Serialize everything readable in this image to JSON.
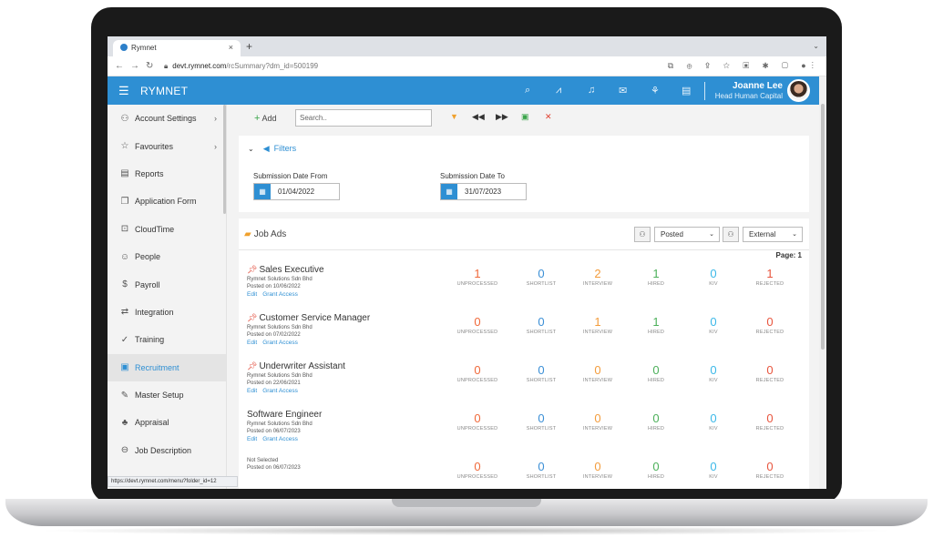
{
  "browser": {
    "tab_title": "Rymnet",
    "tab_close": "×",
    "new_tab": "+",
    "url_host": "devt.rymnet.com",
    "url_path": "/rcSummary?dm_id=500199"
  },
  "app": {
    "brand": "RYMNET",
    "user_name": "Joanne Lee",
    "user_role": "Head Human Capital",
    "accent_color": "#2e8fd3"
  },
  "sidebar": {
    "items": [
      {
        "label": "Account Settings",
        "icon": "account-icon",
        "glyph": "⚇",
        "has_arrow": true
      },
      {
        "label": "Favourites",
        "icon": "star-icon",
        "glyph": "☆",
        "has_arrow": true
      },
      {
        "label": "Reports",
        "icon": "report-icon",
        "glyph": "▤",
        "has_arrow": false
      },
      {
        "label": "Application Form",
        "icon": "form-icon",
        "glyph": "❐",
        "has_arrow": false
      },
      {
        "label": "CloudTime",
        "icon": "clock-icon",
        "glyph": "⊡",
        "has_arrow": false
      },
      {
        "label": "People",
        "icon": "people-icon",
        "glyph": "☺",
        "has_arrow": false
      },
      {
        "label": "Payroll",
        "icon": "dollar-icon",
        "glyph": "$",
        "has_arrow": false
      },
      {
        "label": "Integration",
        "icon": "integration-icon",
        "glyph": "⇄",
        "has_arrow": false
      },
      {
        "label": "Training",
        "icon": "training-icon",
        "glyph": "✓",
        "has_arrow": false
      },
      {
        "label": "Recruitment",
        "icon": "recruitment-icon",
        "glyph": "▣",
        "has_arrow": false,
        "active": true
      },
      {
        "label": "Master Setup",
        "icon": "setup-icon",
        "glyph": "✎",
        "has_arrow": false
      },
      {
        "label": "Appraisal",
        "icon": "appraisal-icon",
        "glyph": "♣",
        "has_arrow": false
      },
      {
        "label": "Job Description",
        "icon": "job-description-icon",
        "glyph": "⊖",
        "has_arrow": false
      }
    ],
    "status_url": "https://devt.rymnet.com/menu?folder_id=12"
  },
  "toolbar": {
    "add_label": "Add",
    "search_placeholder": "Search.."
  },
  "filters": {
    "title": "Filters",
    "from_label": "Submission Date From",
    "from_value": "01/04/2022",
    "to_label": "Submission Date To",
    "to_value": "31/07/2023"
  },
  "jobs": {
    "title": "Job Ads",
    "status_select": "Posted",
    "type_select": "External",
    "page_label": "Page: 1",
    "stat_labels": [
      "UNPROCESSED",
      "SHORTLIST",
      "INTERVIEW",
      "HIRED",
      "KIV",
      "REJECTED"
    ],
    "edit_label": "Edit",
    "grant_label": "Grant Access",
    "rows": [
      {
        "title": "Sales Executive",
        "company": "Rymnet Solutions Sdn Bhd",
        "posted": "Posted on 10/06/2022",
        "pinned": true,
        "stats": [
          "1",
          "0",
          "2",
          "1",
          "0",
          "1"
        ]
      },
      {
        "title": "Customer Service Manager",
        "company": "Rymnet Solutions Sdn Bhd",
        "posted": "Posted on 07/02/2022",
        "pinned": true,
        "stats": [
          "0",
          "0",
          "1",
          "1",
          "0",
          "0"
        ]
      },
      {
        "title": "Underwriter Assistant",
        "company": "Rymnet Solutions Sdn Bhd",
        "posted": "Posted on 22/06/2021",
        "pinned": true,
        "stats": [
          "0",
          "0",
          "0",
          "0",
          "0",
          "0"
        ]
      },
      {
        "title": "Software Engineer",
        "company": "Rymnet Solutions Sdn Bhd",
        "posted": "Posted on 06/07/2023",
        "pinned": false,
        "stats": [
          "0",
          "0",
          "0",
          "0",
          "0",
          "0"
        ]
      },
      {
        "title": "",
        "company": "Not Selected",
        "posted": "Posted on 06/07/2023",
        "pinned": false,
        "stats": [
          "0",
          "0",
          "0",
          "0",
          "0",
          "0"
        ]
      }
    ]
  }
}
